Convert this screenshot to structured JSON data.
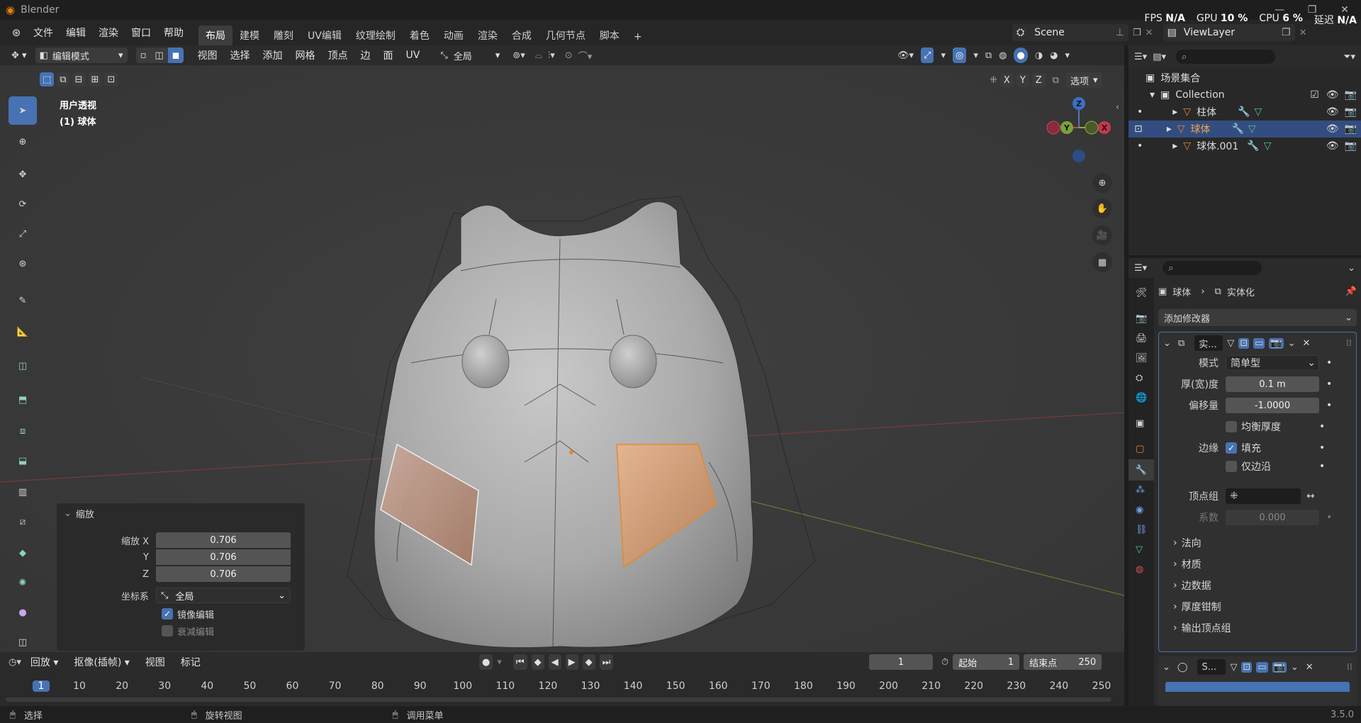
{
  "app": {
    "title": "Blender",
    "version": "3.5.0"
  },
  "menus": [
    "文件",
    "编辑",
    "渲染",
    "窗口",
    "帮助"
  ],
  "workspaces": [
    "布局",
    "建模",
    "雕刻",
    "UV编辑",
    "纹理绘制",
    "着色",
    "动画",
    "渲染",
    "合成",
    "几何节点",
    "脚本"
  ],
  "active_workspace": "布局",
  "stats": {
    "fps_label": "FPS",
    "fps": "N/A",
    "gpu_label": "GPU",
    "gpu": "10 %",
    "cpu_label": "CPU",
    "cpu": "6 %",
    "latency_label": "延迟",
    "latency": "N/A"
  },
  "scene": {
    "name": "Scene",
    "view_layer": "ViewLayer"
  },
  "viewport_header": {
    "mode": "编辑模式",
    "menus": [
      "视图",
      "选择",
      "添加",
      "网格",
      "顶点",
      "边",
      "面",
      "UV"
    ],
    "transform_orientation": "全局",
    "options": "选项",
    "axes": [
      "X",
      "Y",
      "Z"
    ]
  },
  "viewport": {
    "view_name": "用户透视",
    "object_info": "(1) 球体"
  },
  "gizmo": {
    "x": "X",
    "y": "Y",
    "z": "Z"
  },
  "operator_panel": {
    "title": "缩放",
    "scale_x_label": "缩放 X",
    "scale_x": "0.706",
    "scale_y_label": "Y",
    "scale_y": "0.706",
    "scale_z_label": "Z",
    "scale_z": "0.706",
    "orient_label": "坐标系",
    "orient_value": "全局",
    "mirror_label": "镜像编辑",
    "mirror_checked": true,
    "prop_label": "衰减编辑",
    "prop_checked": false
  },
  "outliner": {
    "root": "场景集合",
    "collection": "Collection",
    "items": [
      {
        "name": "柱体",
        "selected": false
      },
      {
        "name": "球体",
        "selected": true
      },
      {
        "name": "球体.001",
        "selected": false
      }
    ]
  },
  "properties": {
    "breadcrumb_object": "球体",
    "breadcrumb_modifier": "实体化",
    "add_modifier": "添加修改器",
    "modifier1_name": "实...",
    "mode_label": "模式",
    "mode_value": "简单型",
    "thickness_label": "厚(宽)度",
    "thickness_value": "0.1 m",
    "offset_label": "偏移量",
    "offset_value": "-1.0000",
    "even_label": "均衡厚度",
    "rim_label": "边缘",
    "fill_label": "填充",
    "rim_only_label": "仅边沿",
    "vgroup_label": "顶点组",
    "factor_label": "系数",
    "factor_value": "0.000",
    "sections": [
      "法向",
      "材质",
      "边数据",
      "厚度钳制",
      "输出顶点组"
    ],
    "modifier2_name": "S..."
  },
  "timeline": {
    "menus": [
      "回放",
      "抠像(插帧)",
      "视图",
      "标记"
    ],
    "current_frame": "1",
    "start_label": "起始",
    "start": "1",
    "end_label": "结束点",
    "end": "250",
    "ticks": [
      "1",
      "10",
      "20",
      "30",
      "40",
      "50",
      "60",
      "70",
      "80",
      "90",
      "100",
      "110",
      "120",
      "130",
      "140",
      "150",
      "160",
      "170",
      "180",
      "190",
      "200",
      "210",
      "220",
      "230",
      "240",
      "250"
    ]
  },
  "statusbar": {
    "select": "选择",
    "rotate": "旋转视图",
    "menu": "调用菜单",
    "version": "3.5.0"
  },
  "colors": {
    "accent": "#4772b3",
    "selected_row": "#334d80",
    "orange": "#e8872c",
    "bg": "#3a3a3a"
  }
}
